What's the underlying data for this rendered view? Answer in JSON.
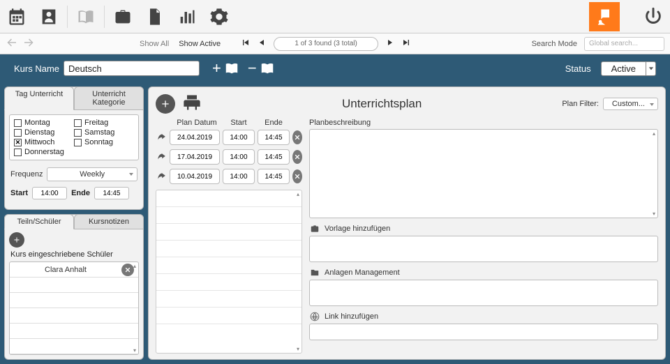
{
  "nav": {
    "show_all": "Show All",
    "show_active": "Show Active",
    "page_text": "1 of 3 found (3 total)",
    "search_mode": "Search Mode",
    "global_placeholder": "Global search..."
  },
  "header": {
    "kurs_label": "Kurs Name",
    "kurs_value": "Deutsch",
    "status_label": "Status",
    "status_value": "Active"
  },
  "left": {
    "tab_tag": "Tag Unterricht",
    "tab_kat": "Unterricht Kategorie",
    "days": {
      "montag": "Montag",
      "dienstag": "Dienstag",
      "mittwoch": "Mittwoch",
      "donnerstag": "Donnerstag",
      "freitag": "Freitag",
      "samstag": "Samstag",
      "sonntag": "Sonntag"
    },
    "frequenz_label": "Frequenz",
    "frequenz_value": "Weekly",
    "start_label": "Start",
    "start_value": "14:00",
    "ende_label": "Ende",
    "ende_value": "14:45",
    "tab_teiln": "Teiln/Schüler",
    "tab_notizen": "Kursnotizen",
    "enrolled_title": "Kurs eingeschriebene Schüler",
    "students": [
      "Clara Anhalt"
    ]
  },
  "right": {
    "title": "Unterrichtsplan",
    "filter_label": "Plan Filter:",
    "filter_value": "Custom...",
    "col_datum": "Plan Datum",
    "col_start": "Start",
    "col_ende": "Ende",
    "plans": [
      {
        "date": "24.04.2019",
        "start": "14:00",
        "end": "14:45"
      },
      {
        "date": "17.04.2019",
        "start": "14:00",
        "end": "14:45"
      },
      {
        "date": "10.04.2019",
        "start": "14:00",
        "end": "14:45"
      }
    ],
    "desc_label": "Planbeschreibung",
    "vorlage_label": "Vorlage hinzufügen",
    "anlagen_label": "Anlagen Management",
    "link_label": "Link hinzufügen"
  }
}
